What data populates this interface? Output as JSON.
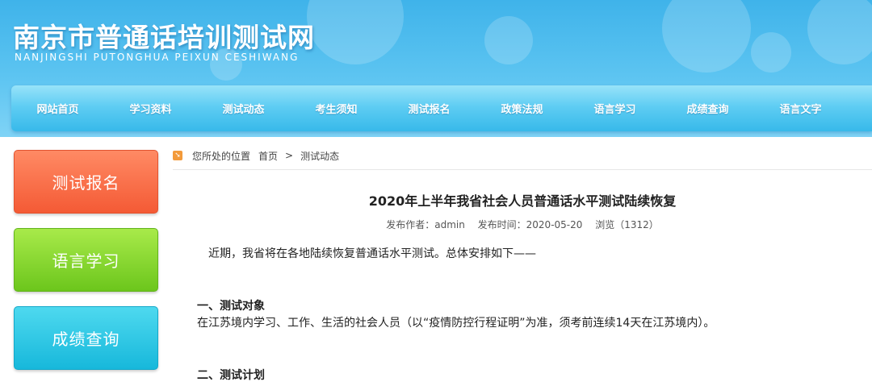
{
  "header": {
    "title": "南京市普通话培训测试网",
    "subtitle": "NANJINGSHI PUTONGHUA PEIXUN CESHIWANG"
  },
  "nav": {
    "items": [
      "网站首页",
      "学习资料",
      "测试动态",
      "考生须知",
      "测试报名",
      "政策法规",
      "语言学习",
      "成绩查询",
      "语言文字"
    ]
  },
  "sidebar": {
    "buttons": [
      {
        "label": "测试报名",
        "color": "#f45a35"
      },
      {
        "label": "语言学习",
        "color": "#6cc61c"
      },
      {
        "label": "成绩查询",
        "color": "#17b8db"
      }
    ]
  },
  "breadcrumb": {
    "prefix": "您所处的位置",
    "home": "首页",
    "separator": ">",
    "current": "测试动态"
  },
  "article": {
    "title": "2020年上半年我省社会人员普通话水平测试陆续恢复",
    "author": "发布作者：admin",
    "date": "发布时间：2020-05-20",
    "views": "浏览（1312）",
    "intro": "近期，我省将在各地陆续恢复普通话水平测试。总体安排如下——",
    "section1_heading": "一、测试对象",
    "section1_text": "在江苏境内学习、工作、生活的社会人员（以“疫情防控行程证明”为准，须考前连续14天在江苏境内）。",
    "section2_heading": "二、测试计划"
  }
}
